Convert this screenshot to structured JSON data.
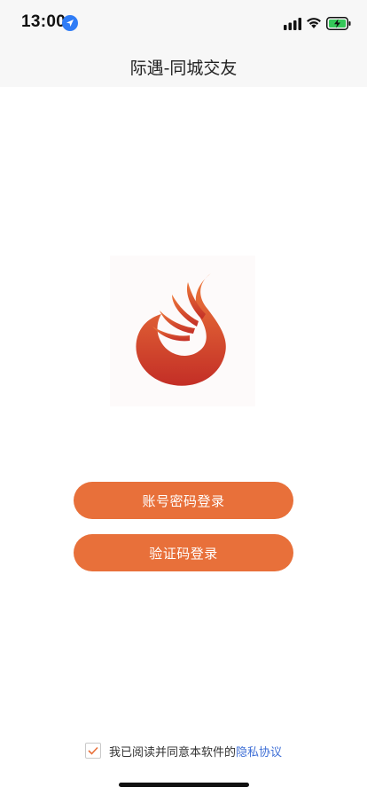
{
  "status_bar": {
    "time": "13:00",
    "icons": [
      "location-arrow-icon",
      "cellular-signal-icon",
      "wifi-icon",
      "battery-charging-icon"
    ]
  },
  "nav": {
    "title": "际遇-同城交友"
  },
  "logo": {
    "icon": "phoenix-logo-icon",
    "colors": [
      "#e8703a",
      "#c8382a"
    ]
  },
  "login": {
    "password_button": "账号密码登录",
    "code_button": "验证码登录",
    "button_color": "#e8703a"
  },
  "agreement": {
    "checked": true,
    "text": "我已阅读并同意本软件的",
    "link": "隐私协议",
    "link_color": "#3f6fd6"
  }
}
